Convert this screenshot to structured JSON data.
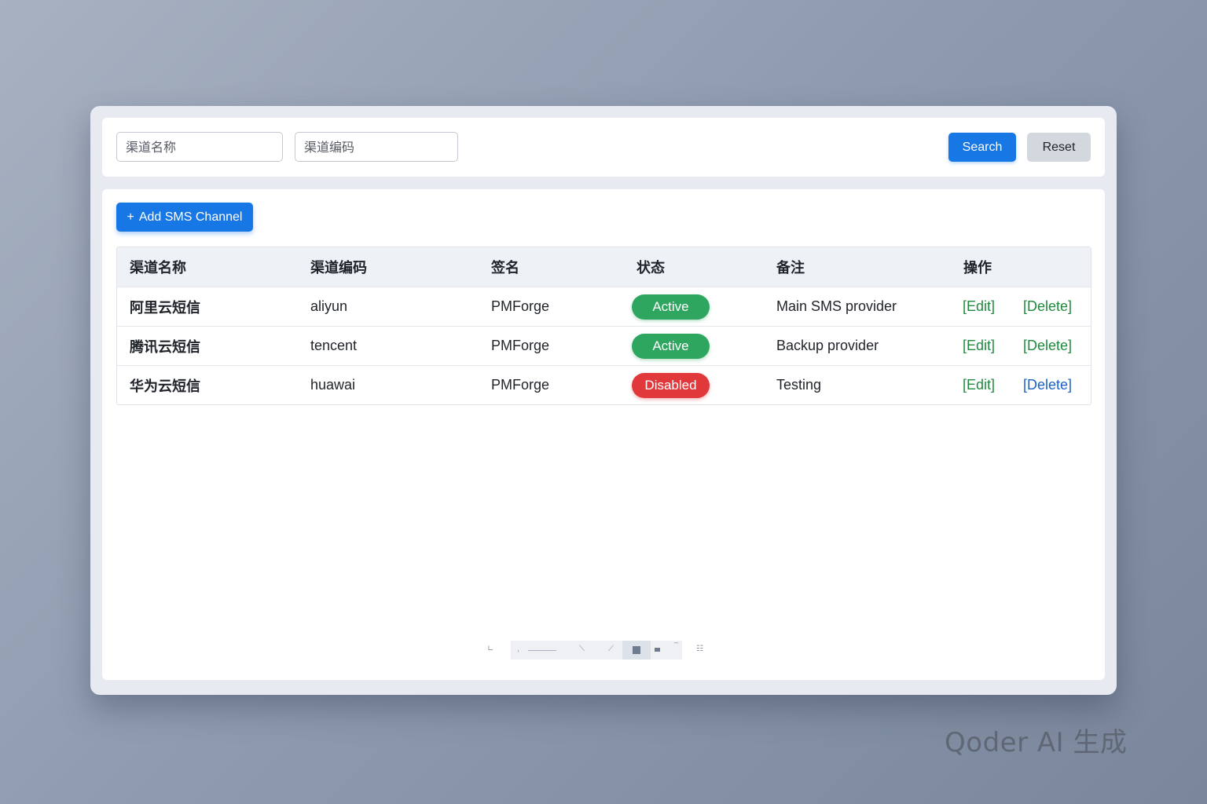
{
  "search": {
    "name_placeholder": "渠道名称",
    "code_placeholder": "渠道编码",
    "search_label": "Search",
    "reset_label": "Reset"
  },
  "toolbar": {
    "add_icon": "+",
    "add_label": "Add SMS Channel"
  },
  "table": {
    "headers": [
      "渠道名称",
      "渠道编码",
      "签名",
      "状态",
      "备注",
      "操作"
    ],
    "rows": [
      {
        "name": "阿里云短信",
        "code": "aliyun",
        "signature": "PMForge",
        "status": "Active",
        "remark": "Main SMS provider",
        "edit": "[Edit]",
        "delete": "[Delete]"
      },
      {
        "name": "腾讯云短信",
        "code": "tencent",
        "signature": "PMForge",
        "status": "Active",
        "remark": "Backup provider",
        "edit": "[Edit]",
        "delete": "[Delete]"
      },
      {
        "name": "华为云短信",
        "code": "huawai",
        "signature": "PMForge",
        "status": "Disabled",
        "remark": "Testing",
        "edit": "[Edit]",
        "delete": "[Delete]"
      }
    ]
  },
  "colors": {
    "primary": "#1677e5",
    "active": "#2ea660",
    "disabled": "#e0383b",
    "edit_link": "#1e8a3e",
    "delete_link_blue": "#1a62c9"
  },
  "watermark": "Qoder AI 生成"
}
